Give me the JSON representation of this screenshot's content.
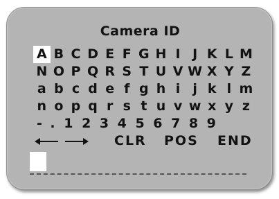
{
  "dialog": {
    "title": "Camera ID"
  },
  "keyboard": {
    "rows": [
      [
        "A",
        "B",
        "C",
        "D",
        "E",
        "F",
        "G",
        "H",
        "I",
        "J",
        "K",
        "L",
        "M"
      ],
      [
        "N",
        "O",
        "P",
        "Q",
        "R",
        "S",
        "T",
        "U",
        "V",
        "W",
        "X",
        "Y",
        "Z"
      ],
      [
        "a",
        "b",
        "c",
        "d",
        "e",
        "f",
        "g",
        "h",
        "i",
        "j",
        "k",
        "l",
        "m"
      ],
      [
        "n",
        "o",
        "p",
        "q",
        "r",
        "s",
        "t",
        "u",
        "v",
        "w",
        "x",
        "y",
        "z"
      ],
      [
        "-",
        ".",
        "1",
        "2",
        "3",
        "4",
        "5",
        "6",
        "7",
        "8",
        "9"
      ]
    ],
    "selected": "A",
    "controls": {
      "left_arrow_icon": "arrow-left-icon",
      "right_arrow_icon": "arrow-right-icon",
      "clear_label": "CLR",
      "position_label": "POS",
      "end_label": "END"
    }
  },
  "entry": {
    "value": "",
    "cursor_visible": true
  },
  "colors": {
    "panel": "#b4b4b4",
    "text": "#121212",
    "highlight": "#ffffff"
  }
}
